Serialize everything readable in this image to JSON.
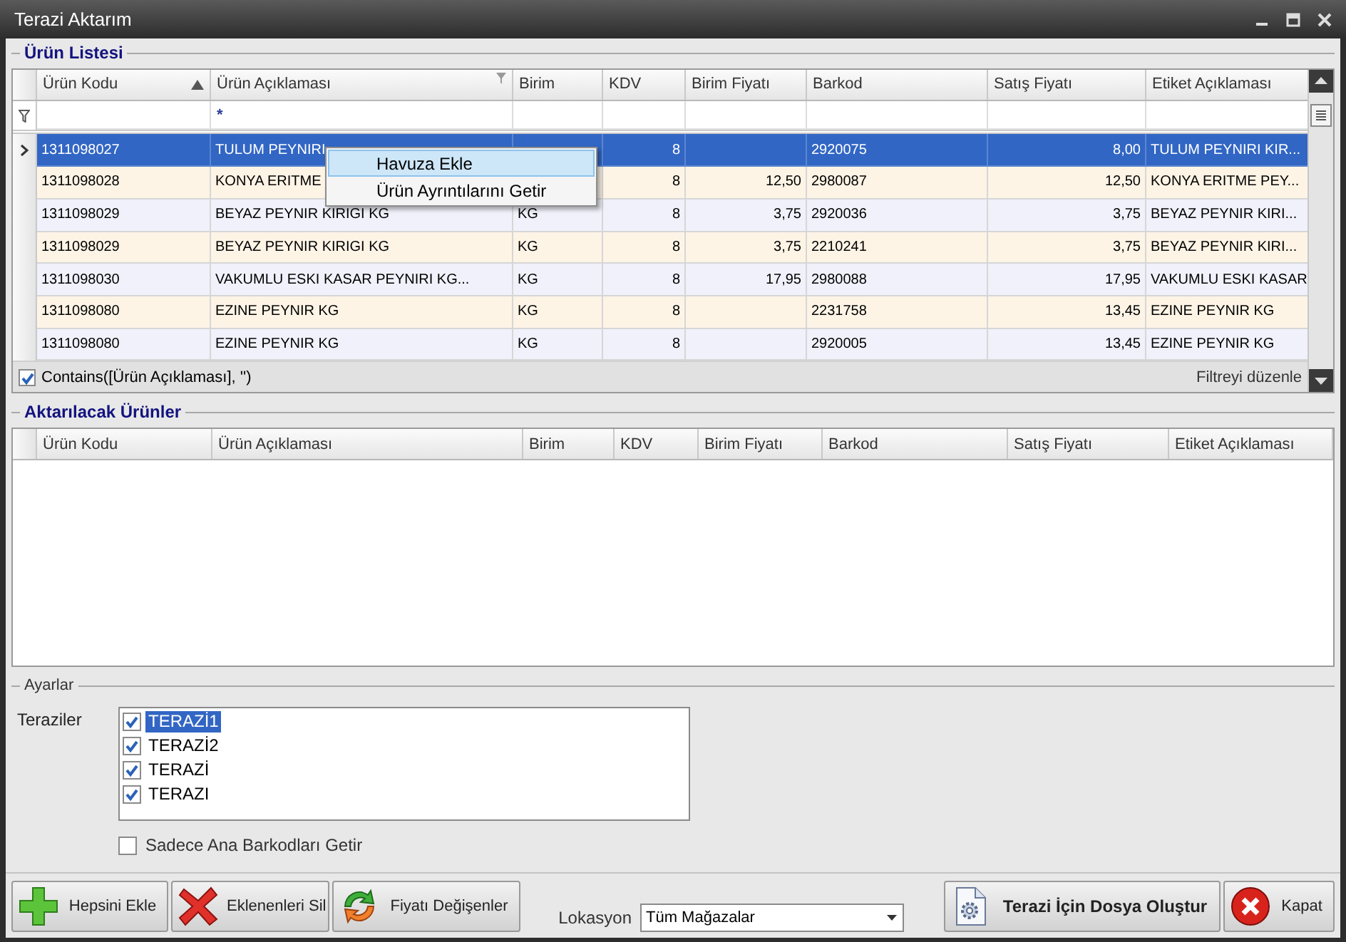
{
  "window": {
    "title": "Terazi Aktarım"
  },
  "product_list": {
    "title": "Ürün Listesi",
    "columns": [
      {
        "label": "Ürün Kodu",
        "sorted": true,
        "filtered": false
      },
      {
        "label": "Ürün Açıklaması",
        "sorted": false,
        "filtered": true,
        "filter_value": "*"
      },
      {
        "label": "Birim",
        "sorted": false,
        "filtered": false
      },
      {
        "label": "KDV",
        "sorted": false,
        "filtered": false
      },
      {
        "label": "Birim Fiyatı",
        "sorted": false,
        "filtered": false
      },
      {
        "label": "Barkod",
        "sorted": false,
        "filtered": false
      },
      {
        "label": "Satış Fiyatı",
        "sorted": false,
        "filtered": false
      },
      {
        "label": "Etiket Açıklaması",
        "sorted": false,
        "filtered": false
      }
    ],
    "rows": [
      {
        "selected": true,
        "cells": [
          "1311098027",
          "TULUM PEYNIRI",
          null,
          "8",
          null,
          "2920075",
          "8,00",
          "TULUM PEYNIRI KIR..."
        ]
      },
      {
        "selected": false,
        "cells": [
          "1311098028",
          "KONYA ERITME",
          null,
          "8",
          "12,50",
          "2980087",
          "12,50",
          "KONYA ERITME PEY..."
        ]
      },
      {
        "selected": false,
        "cells": [
          "1311098029",
          "BEYAZ PEYNIR KIRIGI KG",
          "KG",
          "8",
          "3,75",
          "2920036",
          "3,75",
          "BEYAZ PEYNIR KIRI..."
        ]
      },
      {
        "selected": false,
        "cells": [
          "1311098029",
          "BEYAZ PEYNIR KIRIGI KG",
          "KG",
          "8",
          "3,75",
          "2210241",
          "3,75",
          "BEYAZ PEYNIR KIRI..."
        ]
      },
      {
        "selected": false,
        "cells": [
          "1311098030",
          "VAKUMLU ESKI KASAR PEYNIRI KG...",
          "KG",
          "8",
          "17,95",
          "2980088",
          "17,95",
          "VAKUMLU ESKI KASAR"
        ]
      },
      {
        "selected": false,
        "cells": [
          "1311098080",
          "EZINE PEYNIR KG",
          "KG",
          "8",
          null,
          "2231758",
          "13,45",
          "EZINE PEYNIR KG"
        ]
      },
      {
        "selected": false,
        "cells": [
          "1311098080",
          "EZINE PEYNIR KG",
          "KG",
          "8",
          null,
          "2920005",
          "13,45",
          "EZINE PEYNIR KG"
        ]
      }
    ],
    "filter_bar": {
      "checked": true,
      "expression": "Contains([Ürün Açıklaması], '')",
      "edit_link": "Filtreyi düzenle"
    },
    "context_menu": {
      "items": [
        {
          "label": "Havuza Ekle",
          "selected": true
        },
        {
          "label": "Ürün Ayrıntılarını Getir",
          "selected": false
        }
      ]
    }
  },
  "transfer_list": {
    "title": "Aktarılacak Ürünler",
    "columns": [
      {
        "label": "Ürün Kodu"
      },
      {
        "label": "Ürün Açıklaması"
      },
      {
        "label": "Birim"
      },
      {
        "label": "KDV"
      },
      {
        "label": "Birim Fiyatı"
      },
      {
        "label": "Barkod"
      },
      {
        "label": "Satış Fiyatı"
      },
      {
        "label": "Etiket Açıklaması"
      }
    ]
  },
  "settings": {
    "title": "Ayarlar",
    "scales_label": "Teraziler",
    "scales": [
      {
        "label": "TERAZİ1",
        "checked": true,
        "selected": true
      },
      {
        "label": "TERAZİ2",
        "checked": true,
        "selected": false
      },
      {
        "label": "TERAZİ",
        "checked": true,
        "selected": false
      },
      {
        "label": "TERAZI",
        "checked": true,
        "selected": false
      }
    ],
    "main_barcodes_only": {
      "label": "Sadece Ana Barkodları Getir",
      "checked": false
    }
  },
  "toolbar": {
    "left_buttons": [
      {
        "label": "Hepsini Ekle",
        "kind": "add"
      },
      {
        "label": "Eklenenleri Sil",
        "kind": "delete"
      },
      {
        "label": "Fiyatı Değişenler",
        "kind": "refresh"
      }
    ],
    "location": {
      "label": "Lokasyon",
      "value": "Tüm Mağazalar"
    },
    "right_buttons": [
      {
        "label": "Terazi İçin Dosya Oluştur",
        "kind": "file",
        "default": true
      },
      {
        "label": "Kapat",
        "kind": "close",
        "default": false
      }
    ]
  }
}
